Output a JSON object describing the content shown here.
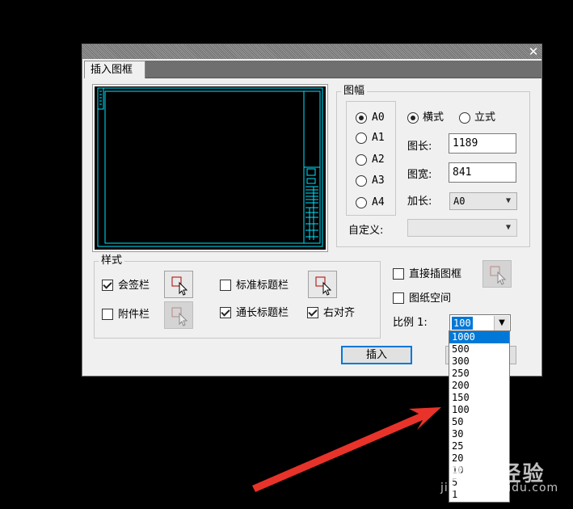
{
  "dialog": {
    "close_glyph": "✕",
    "tab_label": "插入图框"
  },
  "sheet_group": {
    "title": "图幅",
    "sizes": [
      "A0",
      "A1",
      "A2",
      "A3",
      "A4"
    ],
    "selected_size": "A0",
    "orientation": {
      "landscape": "横式",
      "portrait": "立式",
      "selected": "landscape"
    },
    "length_label": "图长:",
    "length_value": "1189",
    "width_label": "图宽:",
    "width_value": "841",
    "extend_label": "加长:",
    "extend_value": "A0",
    "custom_label": "自定义:",
    "custom_value": ""
  },
  "style_group": {
    "title": "样式",
    "countersign": {
      "label": "会签栏",
      "checked": true
    },
    "standard_title": {
      "label": "标准标题栏",
      "checked": false
    },
    "attachment": {
      "label": "附件栏",
      "checked": false
    },
    "long_title": {
      "label": "通长标题栏",
      "checked": true
    },
    "align_right": {
      "label": "右对齐",
      "checked": true
    }
  },
  "options": {
    "direct_insert": {
      "label": "直接插图框",
      "checked": false
    },
    "paper_space": {
      "label": "图纸空间",
      "checked": false
    },
    "ratio_label": "比例 1:",
    "ratio_value": "100"
  },
  "ratio_options": [
    "1000",
    "500",
    "300",
    "250",
    "200",
    "150",
    "100",
    "50",
    "30",
    "25",
    "20",
    "10",
    "5",
    "1"
  ],
  "ratio_highlight_index": 0,
  "buttons": {
    "insert": "插入"
  },
  "watermark": {
    "brand": "Bai 经验",
    "url": "jingyan.baidu.com"
  },
  "colors": {
    "accent": "#0078d7",
    "preview_line": "#00e5ff",
    "arrow": "#e8332a"
  }
}
